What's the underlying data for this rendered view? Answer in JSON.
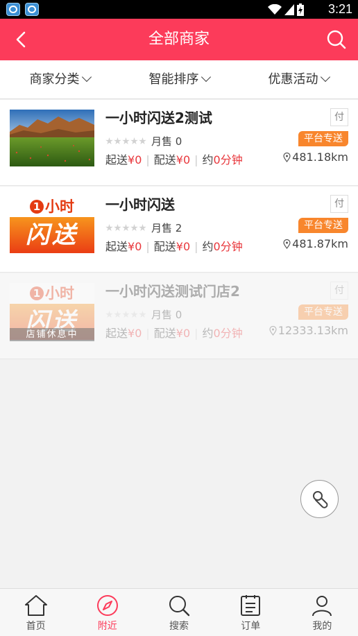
{
  "status_bar": {
    "time": "3:21"
  },
  "header": {
    "title": "全部商家"
  },
  "filters": [
    {
      "label": "商家分类"
    },
    {
      "label": "智能排序"
    },
    {
      "label": "优惠活动"
    }
  ],
  "stores": [
    {
      "name": "一小时闪送2测试",
      "sales": "月售 0",
      "min_label": "起送",
      "min_value": "¥0",
      "fee_label": "配送",
      "fee_value": "¥0",
      "time_label": "约",
      "time_value": "0分钟",
      "pay": "付",
      "tag": "平台专送",
      "distance": "481.18km",
      "rating": 0,
      "closed": false
    },
    {
      "name": "一小时闪送",
      "sales": "月售 2",
      "min_label": "起送",
      "min_value": "¥0",
      "fee_label": "配送",
      "fee_value": "¥0",
      "time_label": "约",
      "time_value": "0分钟",
      "pay": "付",
      "tag": "平台专送",
      "distance": "481.87km",
      "rating": 0,
      "logo_top": "小时",
      "logo_num": "1",
      "logo_bottom": "闪送",
      "closed": false
    },
    {
      "name": "一小时闪送测试门店2",
      "sales": "月售 0",
      "min_label": "起送",
      "min_value": "¥0",
      "fee_label": "配送",
      "fee_value": "¥0",
      "time_label": "约",
      "time_value": "0分钟",
      "pay": "付",
      "tag": "平台专送",
      "distance": "12333.13km",
      "rating": 0,
      "logo_top": "小时",
      "logo_num": "1",
      "logo_bottom": "闪送",
      "closed": true,
      "closed_label": "店铺休息中"
    }
  ],
  "bottom_nav": [
    {
      "label": "首页",
      "icon": "home-icon"
    },
    {
      "label": "附近",
      "icon": "compass-icon",
      "active": true
    },
    {
      "label": "搜索",
      "icon": "search-icon"
    },
    {
      "label": "订单",
      "icon": "order-icon"
    },
    {
      "label": "我的",
      "icon": "user-icon"
    }
  ],
  "colors": {
    "brand": "#fc3b5a",
    "price": "#e8363b",
    "tag": "#f8862d"
  }
}
